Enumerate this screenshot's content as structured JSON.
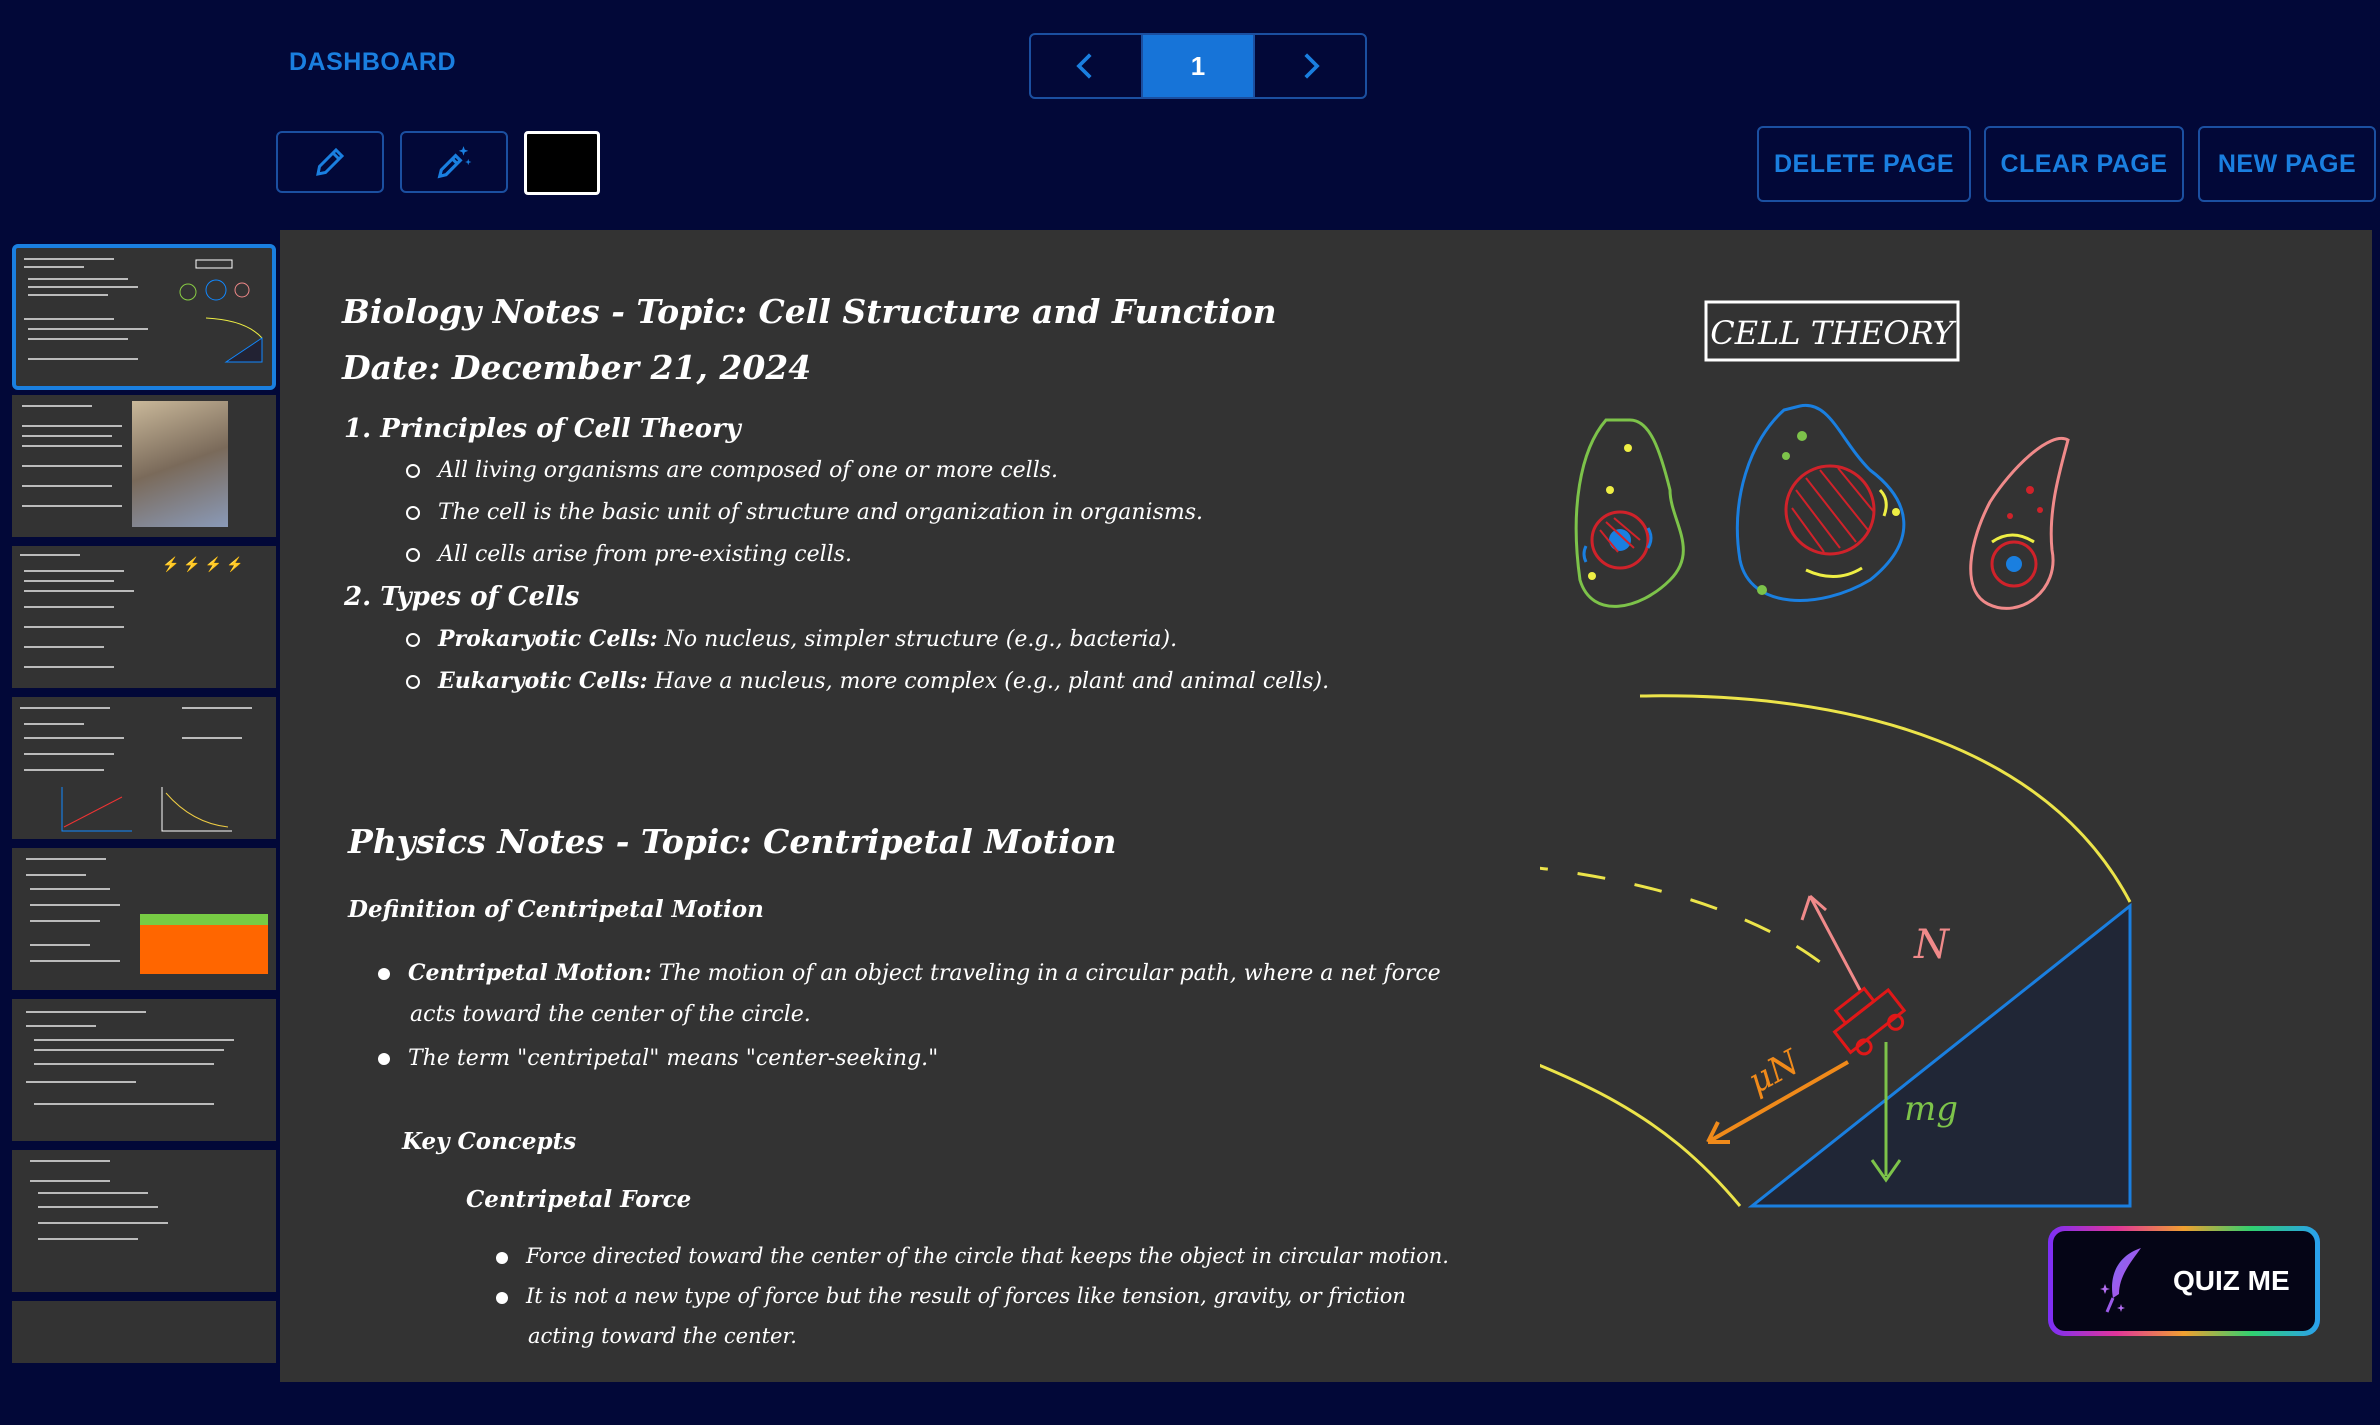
{
  "header": {
    "dashboard_label": "DASHBOARD",
    "page_number": "1"
  },
  "toolbar": {
    "current_color": "#000000",
    "delete_label": "DELETE PAGE",
    "clear_label": "CLEAR PAGE",
    "new_label": "NEW PAGE"
  },
  "notes": {
    "bio_title": "Biology Notes - Topic: Cell Structure and Function",
    "bio_date": "Date: December 21, 2024",
    "sec1": "1.  Principles of Cell Theory",
    "sec1_items": [
      "All living organisms are composed of one or more cells.",
      "The cell is the basic unit of structure and organization in organisms.",
      "All cells arise from pre-existing cells."
    ],
    "sec2": "2.  Types of Cells",
    "prok_label": "Prokaryotic Cells:",
    "prok_text": " No nucleus, simpler structure (e.g., bacteria).",
    "euk_label": "Eukaryotic Cells:",
    "euk_text": " Have a nucleus, more complex (e.g., plant and animal cells).",
    "phys_title": "Physics Notes - Topic: Centripetal Motion",
    "def_heading": "Definition of Centripetal Motion",
    "cm_label": "Centripetal Motion:",
    "cm_text": " The motion of an object traveling in a circular path, where a net force",
    "cm_text2": "acts toward the center of the circle.",
    "term_text": "The term \"centripetal\" means \"center-seeking.\"",
    "key_concepts": "Key Concepts",
    "cf_heading": "Centripetal Force",
    "cf_items": [
      "Force directed toward the center of the circle that keeps the object in circular motion.",
      "It is not a new type of force but the result of forces like tension, gravity, or friction"
    ],
    "cf_cont": "acting toward the center."
  },
  "drawing": {
    "cell_theory_label": "CELL THEORY",
    "normal_label": "N",
    "friction_label": "μN",
    "gravity_label": "mg"
  },
  "quiz": {
    "label": "QUIZ ME"
  },
  "colors": {
    "accent": "#1a7fe0",
    "background": "#020838",
    "canvas": "#333333"
  }
}
